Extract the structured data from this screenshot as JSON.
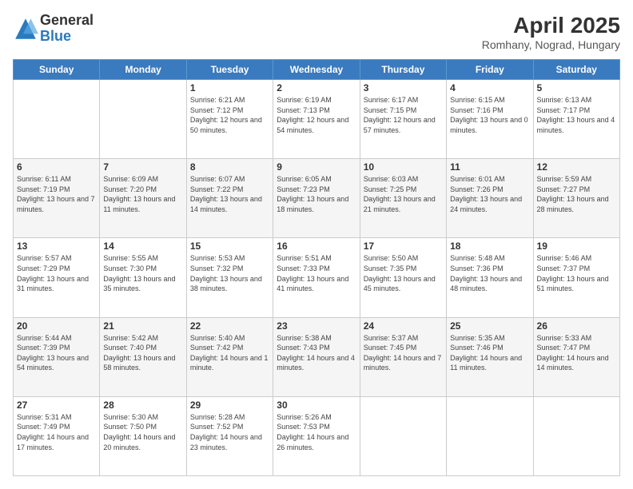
{
  "logo": {
    "general": "General",
    "blue": "Blue"
  },
  "title": "April 2025",
  "location": "Romhany, Nograd, Hungary",
  "days_header": [
    "Sunday",
    "Monday",
    "Tuesday",
    "Wednesday",
    "Thursday",
    "Friday",
    "Saturday"
  ],
  "weeks": [
    [
      {
        "day": "",
        "info": ""
      },
      {
        "day": "",
        "info": ""
      },
      {
        "day": "1",
        "info": "Sunrise: 6:21 AM\nSunset: 7:12 PM\nDaylight: 12 hours and 50 minutes."
      },
      {
        "day": "2",
        "info": "Sunrise: 6:19 AM\nSunset: 7:13 PM\nDaylight: 12 hours and 54 minutes."
      },
      {
        "day": "3",
        "info": "Sunrise: 6:17 AM\nSunset: 7:15 PM\nDaylight: 12 hours and 57 minutes."
      },
      {
        "day": "4",
        "info": "Sunrise: 6:15 AM\nSunset: 7:16 PM\nDaylight: 13 hours and 0 minutes."
      },
      {
        "day": "5",
        "info": "Sunrise: 6:13 AM\nSunset: 7:17 PM\nDaylight: 13 hours and 4 minutes."
      }
    ],
    [
      {
        "day": "6",
        "info": "Sunrise: 6:11 AM\nSunset: 7:19 PM\nDaylight: 13 hours and 7 minutes."
      },
      {
        "day": "7",
        "info": "Sunrise: 6:09 AM\nSunset: 7:20 PM\nDaylight: 13 hours and 11 minutes."
      },
      {
        "day": "8",
        "info": "Sunrise: 6:07 AM\nSunset: 7:22 PM\nDaylight: 13 hours and 14 minutes."
      },
      {
        "day": "9",
        "info": "Sunrise: 6:05 AM\nSunset: 7:23 PM\nDaylight: 13 hours and 18 minutes."
      },
      {
        "day": "10",
        "info": "Sunrise: 6:03 AM\nSunset: 7:25 PM\nDaylight: 13 hours and 21 minutes."
      },
      {
        "day": "11",
        "info": "Sunrise: 6:01 AM\nSunset: 7:26 PM\nDaylight: 13 hours and 24 minutes."
      },
      {
        "day": "12",
        "info": "Sunrise: 5:59 AM\nSunset: 7:27 PM\nDaylight: 13 hours and 28 minutes."
      }
    ],
    [
      {
        "day": "13",
        "info": "Sunrise: 5:57 AM\nSunset: 7:29 PM\nDaylight: 13 hours and 31 minutes."
      },
      {
        "day": "14",
        "info": "Sunrise: 5:55 AM\nSunset: 7:30 PM\nDaylight: 13 hours and 35 minutes."
      },
      {
        "day": "15",
        "info": "Sunrise: 5:53 AM\nSunset: 7:32 PM\nDaylight: 13 hours and 38 minutes."
      },
      {
        "day": "16",
        "info": "Sunrise: 5:51 AM\nSunset: 7:33 PM\nDaylight: 13 hours and 41 minutes."
      },
      {
        "day": "17",
        "info": "Sunrise: 5:50 AM\nSunset: 7:35 PM\nDaylight: 13 hours and 45 minutes."
      },
      {
        "day": "18",
        "info": "Sunrise: 5:48 AM\nSunset: 7:36 PM\nDaylight: 13 hours and 48 minutes."
      },
      {
        "day": "19",
        "info": "Sunrise: 5:46 AM\nSunset: 7:37 PM\nDaylight: 13 hours and 51 minutes."
      }
    ],
    [
      {
        "day": "20",
        "info": "Sunrise: 5:44 AM\nSunset: 7:39 PM\nDaylight: 13 hours and 54 minutes."
      },
      {
        "day": "21",
        "info": "Sunrise: 5:42 AM\nSunset: 7:40 PM\nDaylight: 13 hours and 58 minutes."
      },
      {
        "day": "22",
        "info": "Sunrise: 5:40 AM\nSunset: 7:42 PM\nDaylight: 14 hours and 1 minute."
      },
      {
        "day": "23",
        "info": "Sunrise: 5:38 AM\nSunset: 7:43 PM\nDaylight: 14 hours and 4 minutes."
      },
      {
        "day": "24",
        "info": "Sunrise: 5:37 AM\nSunset: 7:45 PM\nDaylight: 14 hours and 7 minutes."
      },
      {
        "day": "25",
        "info": "Sunrise: 5:35 AM\nSunset: 7:46 PM\nDaylight: 14 hours and 11 minutes."
      },
      {
        "day": "26",
        "info": "Sunrise: 5:33 AM\nSunset: 7:47 PM\nDaylight: 14 hours and 14 minutes."
      }
    ],
    [
      {
        "day": "27",
        "info": "Sunrise: 5:31 AM\nSunset: 7:49 PM\nDaylight: 14 hours and 17 minutes."
      },
      {
        "day": "28",
        "info": "Sunrise: 5:30 AM\nSunset: 7:50 PM\nDaylight: 14 hours and 20 minutes."
      },
      {
        "day": "29",
        "info": "Sunrise: 5:28 AM\nSunset: 7:52 PM\nDaylight: 14 hours and 23 minutes."
      },
      {
        "day": "30",
        "info": "Sunrise: 5:26 AM\nSunset: 7:53 PM\nDaylight: 14 hours and 26 minutes."
      },
      {
        "day": "",
        "info": ""
      },
      {
        "day": "",
        "info": ""
      },
      {
        "day": "",
        "info": ""
      }
    ]
  ]
}
